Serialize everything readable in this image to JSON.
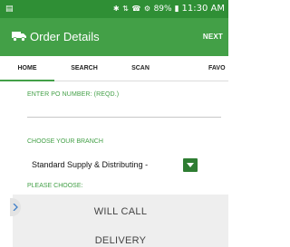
{
  "status_bar": {
    "icons": [
      "bluetooth-icon",
      "nfc-icon",
      "vibrate-icon",
      "alarm-icon",
      "data-icon",
      "signal-icon",
      "battery-icon"
    ],
    "battery": "89%",
    "time": "11:30 AM"
  },
  "app_bar": {
    "title": "Order Details",
    "next_label": "NEXT",
    "icon": "truck-icon"
  },
  "tabs": [
    {
      "label": "HOME",
      "active": true
    },
    {
      "label": "SEARCH",
      "active": false
    },
    {
      "label": "SCAN",
      "active": false
    },
    {
      "label": "FAVO",
      "active": false
    }
  ],
  "form": {
    "po_label": "ENTER PO NUMBER: (REQD.)",
    "po_value": "",
    "branch_label": "CHOOSE YOUR BRANCH",
    "branch_selected": "Standard Supply & Distributing -",
    "choose_label": "PLEASE CHOOSE:",
    "options": [
      "WILL CALL",
      "DELIVERY"
    ]
  },
  "colors": {
    "status_bar": "#2f8f35",
    "app_bar": "#43a047",
    "accent": "#43a047",
    "dropdown": "#2e7d32"
  }
}
